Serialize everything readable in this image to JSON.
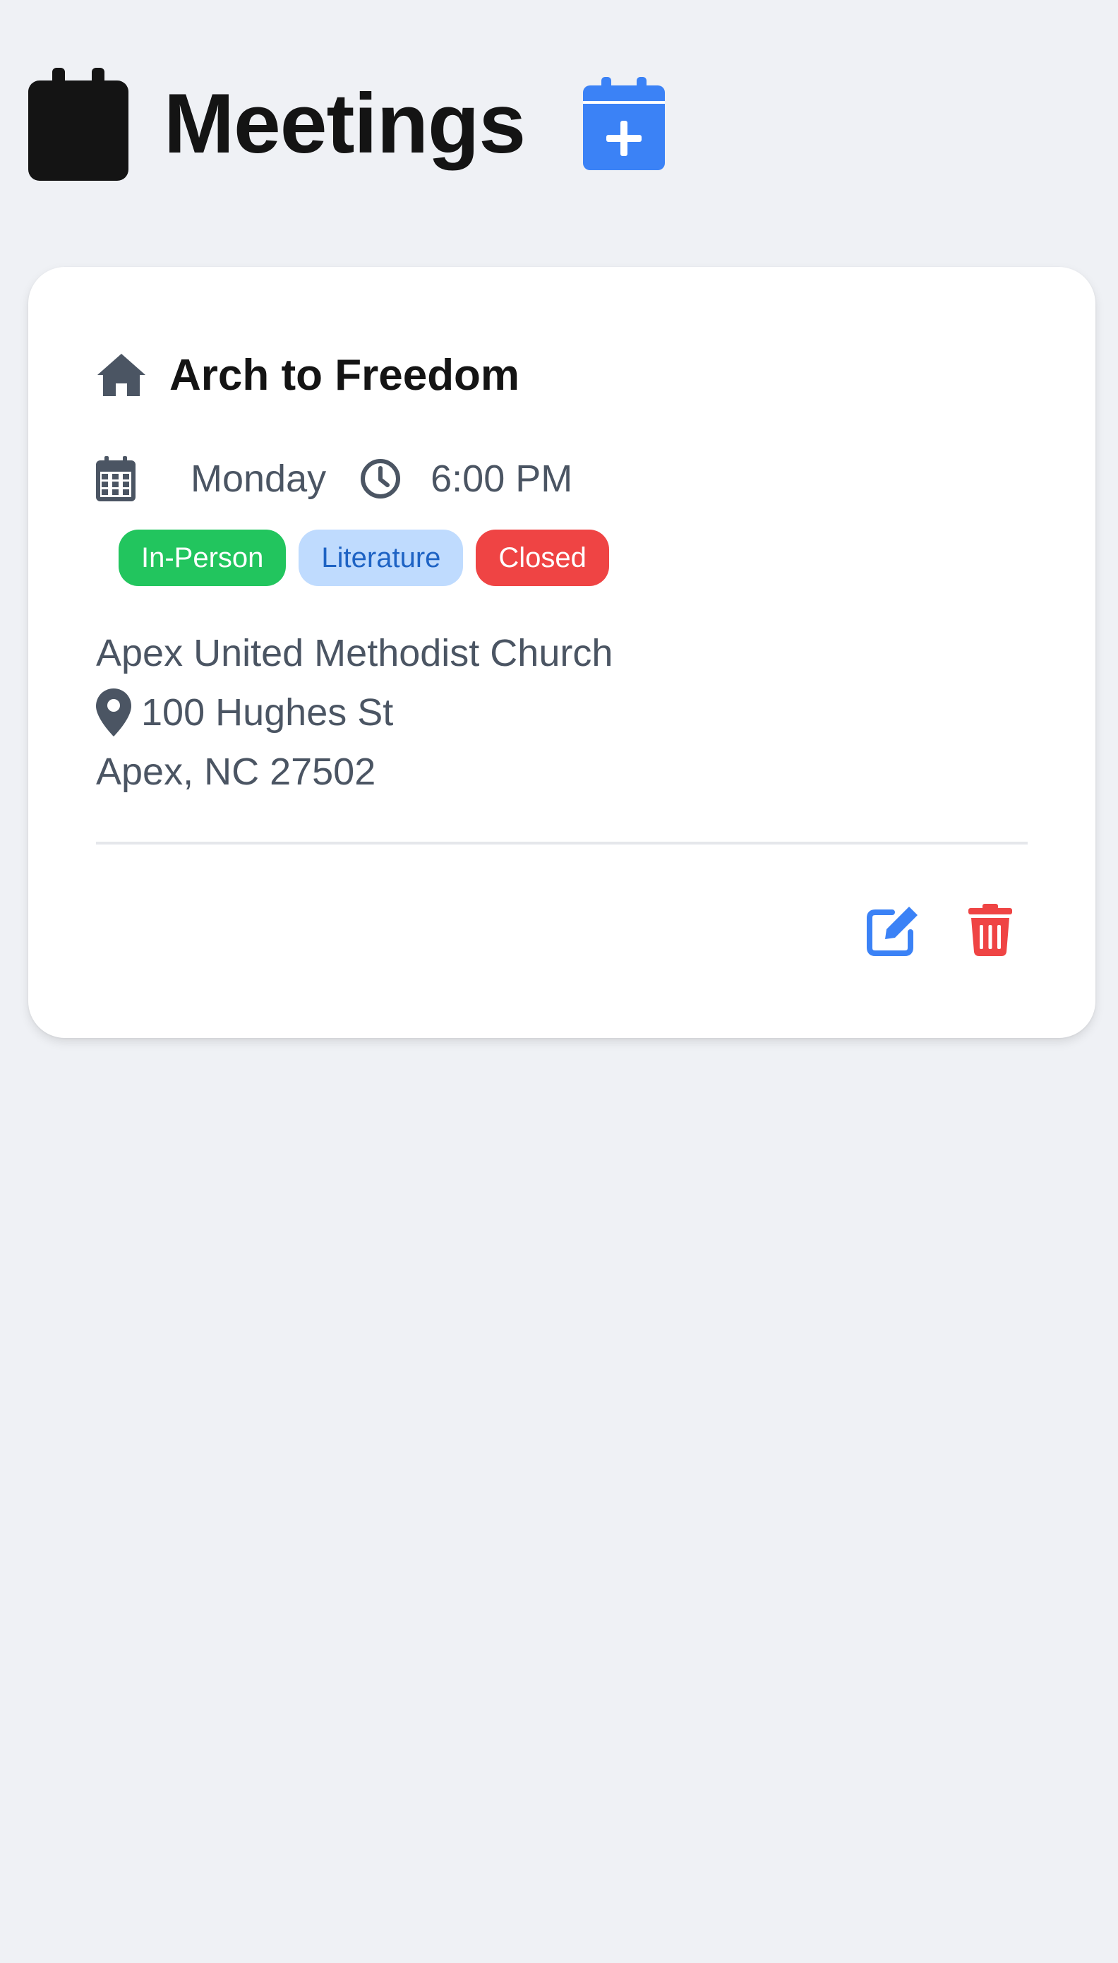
{
  "header": {
    "title": "Meetings",
    "icon": "calendar-icon",
    "add_button_icon": "calendar-plus-icon"
  },
  "colors": {
    "accent": "#3b82f6",
    "danger": "#ef4444",
    "success": "#22c55e",
    "badge_light_blue": "#bfdbfe",
    "text_muted": "#4b5563",
    "background": "#eff1f5"
  },
  "meetings": [
    {
      "icon": "home-icon",
      "name": "Arch to Freedom",
      "day": "Monday",
      "time": "6:00 PM",
      "badges": [
        {
          "label": "In-Person"
        },
        {
          "label": "Literature"
        },
        {
          "label": "Closed"
        }
      ],
      "location_name": "Apex United Methodist Church",
      "street": "100 Hughes St",
      "city_state_zip": "Apex, NC 27502",
      "actions": {
        "edit_icon": "edit-icon",
        "delete_icon": "trash-icon"
      }
    }
  ]
}
